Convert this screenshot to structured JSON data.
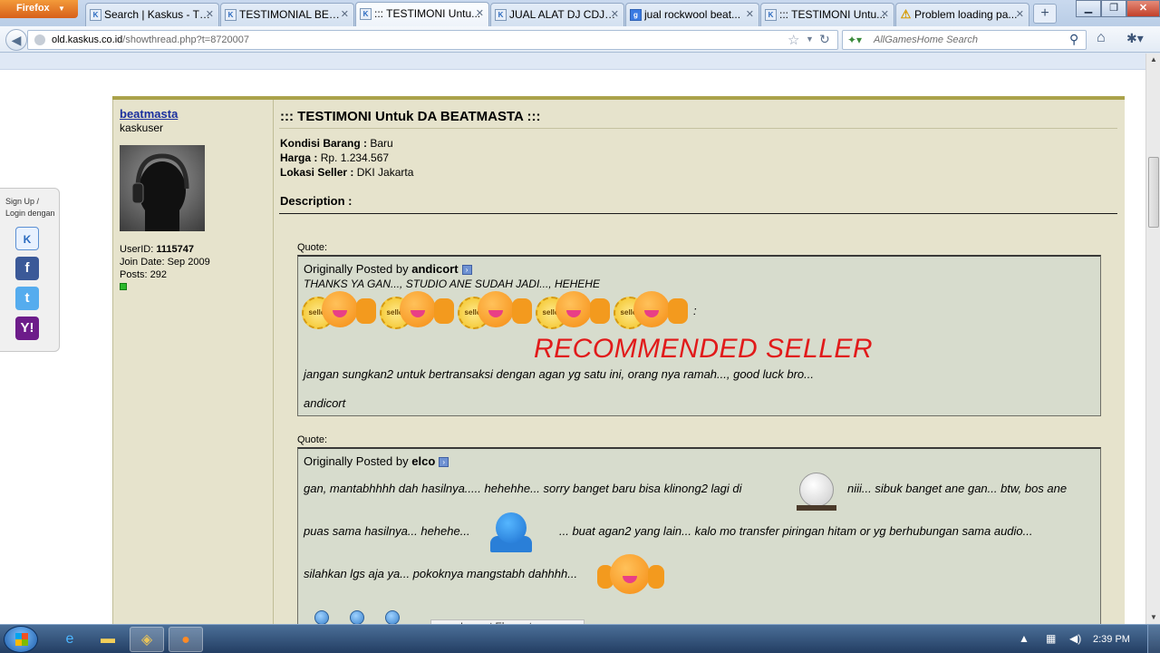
{
  "browser": {
    "menu_label": "Firefox",
    "tabs": [
      {
        "title": "Search | Kaskus - Th...",
        "icon": "kaskus-favicon",
        "active": false
      },
      {
        "title": "TESTIMONIAL BEAT...",
        "icon": "kaskus-favicon",
        "active": false
      },
      {
        "title": "::: TESTIMONI Untu...",
        "icon": "kaskus-favicon",
        "active": true
      },
      {
        "title": "JUAL ALAT DJ CDJ ...",
        "icon": "kaskus-favicon",
        "active": false
      },
      {
        "title": "jual rockwool beat...",
        "icon": "google-favicon",
        "active": false
      },
      {
        "title": "::: TESTIMONI Untu...",
        "icon": "kaskus-favicon",
        "active": false
      },
      {
        "title": "Problem loading pa...",
        "icon": "warning-icon",
        "active": false
      }
    ],
    "url_domain": "old.kaskus.co.id",
    "url_path": "/showthread.php?t=8720007",
    "search_placeholder": "AllGamesHome Search"
  },
  "login_widget": {
    "line1": "Sign Up /",
    "line2": "Login dengan"
  },
  "post": {
    "username": "beatmasta",
    "user_title": "kaskuser",
    "user_id_label": "UserID:",
    "user_id": "1115747",
    "join_date": "Join Date: Sep 2009",
    "posts": "Posts: 292",
    "title": "::: TESTIMONI Untuk DA BEATMASTA :::",
    "kondisi_label": "Kondisi Barang :",
    "kondisi_value": "Baru",
    "harga_label": "Harga :",
    "harga_value": "Rp. 1.234.567",
    "lokasi_label": "Lokasi Seller :",
    "lokasi_value": "DKI Jakarta",
    "description_label": "Description :"
  },
  "quotes": [
    {
      "label": "Quote:",
      "prefix": "Originally Posted by",
      "author": "andicort",
      "line1": "THANKS YA GAN..., STUDIO ANE SUDAH JADI..., HEHEHE",
      "badge_text": "seller",
      "badge_trail": ":",
      "recommended": "RECOMMENDED SELLER",
      "line2": "jangan sungkan2 untuk bertransaksi dengan agan yg satu ini, orang nya ramah..., good luck bro...",
      "signature": "andicort"
    },
    {
      "label": "Quote:",
      "prefix": "Originally Posted by",
      "author": "elco",
      "line1a": "gan, mantabhhhh dah hasilnya..... hehehhe... sorry banget baru bisa klinong2 lagi di",
      "line1b": "niii... sibuk banget ane gan... btw, bos ane",
      "line2a": "puas sama hasilnya... hehehe...",
      "line2b": "... buat agan2 yang lain... kalo mo transfer piringan hitam or yg berhubungan sama audio...",
      "line3": "silahkan lgs aja ya... pokoknya mangstabh dahhhh..."
    }
  ],
  "inspect_tooltip": "Inspect Element",
  "taskbar": {
    "clock": "2:39 PM"
  }
}
